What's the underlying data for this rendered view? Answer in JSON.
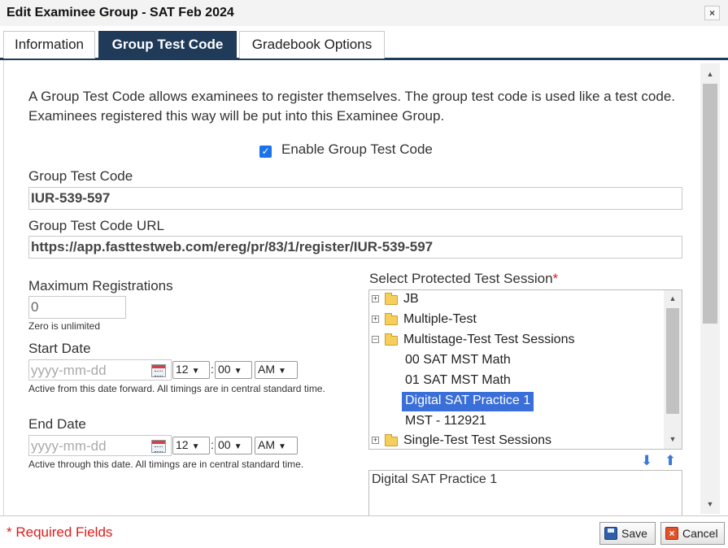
{
  "window": {
    "title": "Edit Examinee Group - SAT Feb 2024",
    "close_glyph": "×"
  },
  "tabs": [
    {
      "label": "Information"
    },
    {
      "label": "Group Test Code"
    },
    {
      "label": "Gradebook Options"
    }
  ],
  "active_tab": "Group Test Code",
  "form": {
    "description": "A Group Test Code allows examinees to register themselves. The group test code is used like a test code. Examinees registered this way will be put into this Examinee Group.",
    "enable_label": "Enable Group Test Code",
    "enable_checked": true,
    "group_code_label": "Group Test Code",
    "group_code_value": "IUR-539-597",
    "url_label": "Group Test Code URL",
    "url_value": "https://app.fasttestweb.com/ereg/pr/83/1/register/IUR-539-597",
    "max_reg_label": "Maximum Registrations",
    "max_reg_value": "0",
    "max_reg_hint": "Zero is unlimited",
    "start_date": {
      "label": "Start Date",
      "placeholder": "yyyy-mm-dd",
      "hour": "12",
      "minute": "00",
      "ampm": "AM",
      "hint": "Active from this date forward. All timings are in central standard time."
    },
    "end_date": {
      "label": "End Date",
      "placeholder": "yyyy-mm-dd",
      "hour": "12",
      "minute": "00",
      "ampm": "AM",
      "hint": "Active through this date. All timings are in central standard time."
    },
    "time_separator": ":"
  },
  "session_picker": {
    "label": "Select Protected Test Session",
    "required_marker": "*",
    "tree": {
      "jb": "JB",
      "multiple_test": "Multiple-Test",
      "multistage": "Multistage-Test Test Sessions",
      "mst_math_00": "00 SAT MST Math",
      "mst_math_01": "01 SAT MST Math",
      "digital_sat": "Digital SAT Practice 1",
      "mst_112921": "MST - 112921",
      "single_test": "Single-Test Test Sessions"
    },
    "selected": "Digital SAT Practice 1",
    "selected_box_value": "Digital SAT Practice 1"
  },
  "footer": {
    "required_note": "* Required Fields",
    "save_label": "Save",
    "cancel_label": "Cancel"
  },
  "colors": {
    "active_tab_bg": "#203a5a",
    "selection_bg": "#3a6ed8",
    "required_red": "#e21a1a",
    "checkbox_blue": "#1a73e8"
  },
  "icons": {
    "close": "close-icon",
    "calendar": "calendar-icon",
    "folder": "folder-icon",
    "move_down": "arrow-down-icon",
    "move_up": "arrow-up-icon",
    "save": "save-icon",
    "cancel": "cancel-icon"
  }
}
